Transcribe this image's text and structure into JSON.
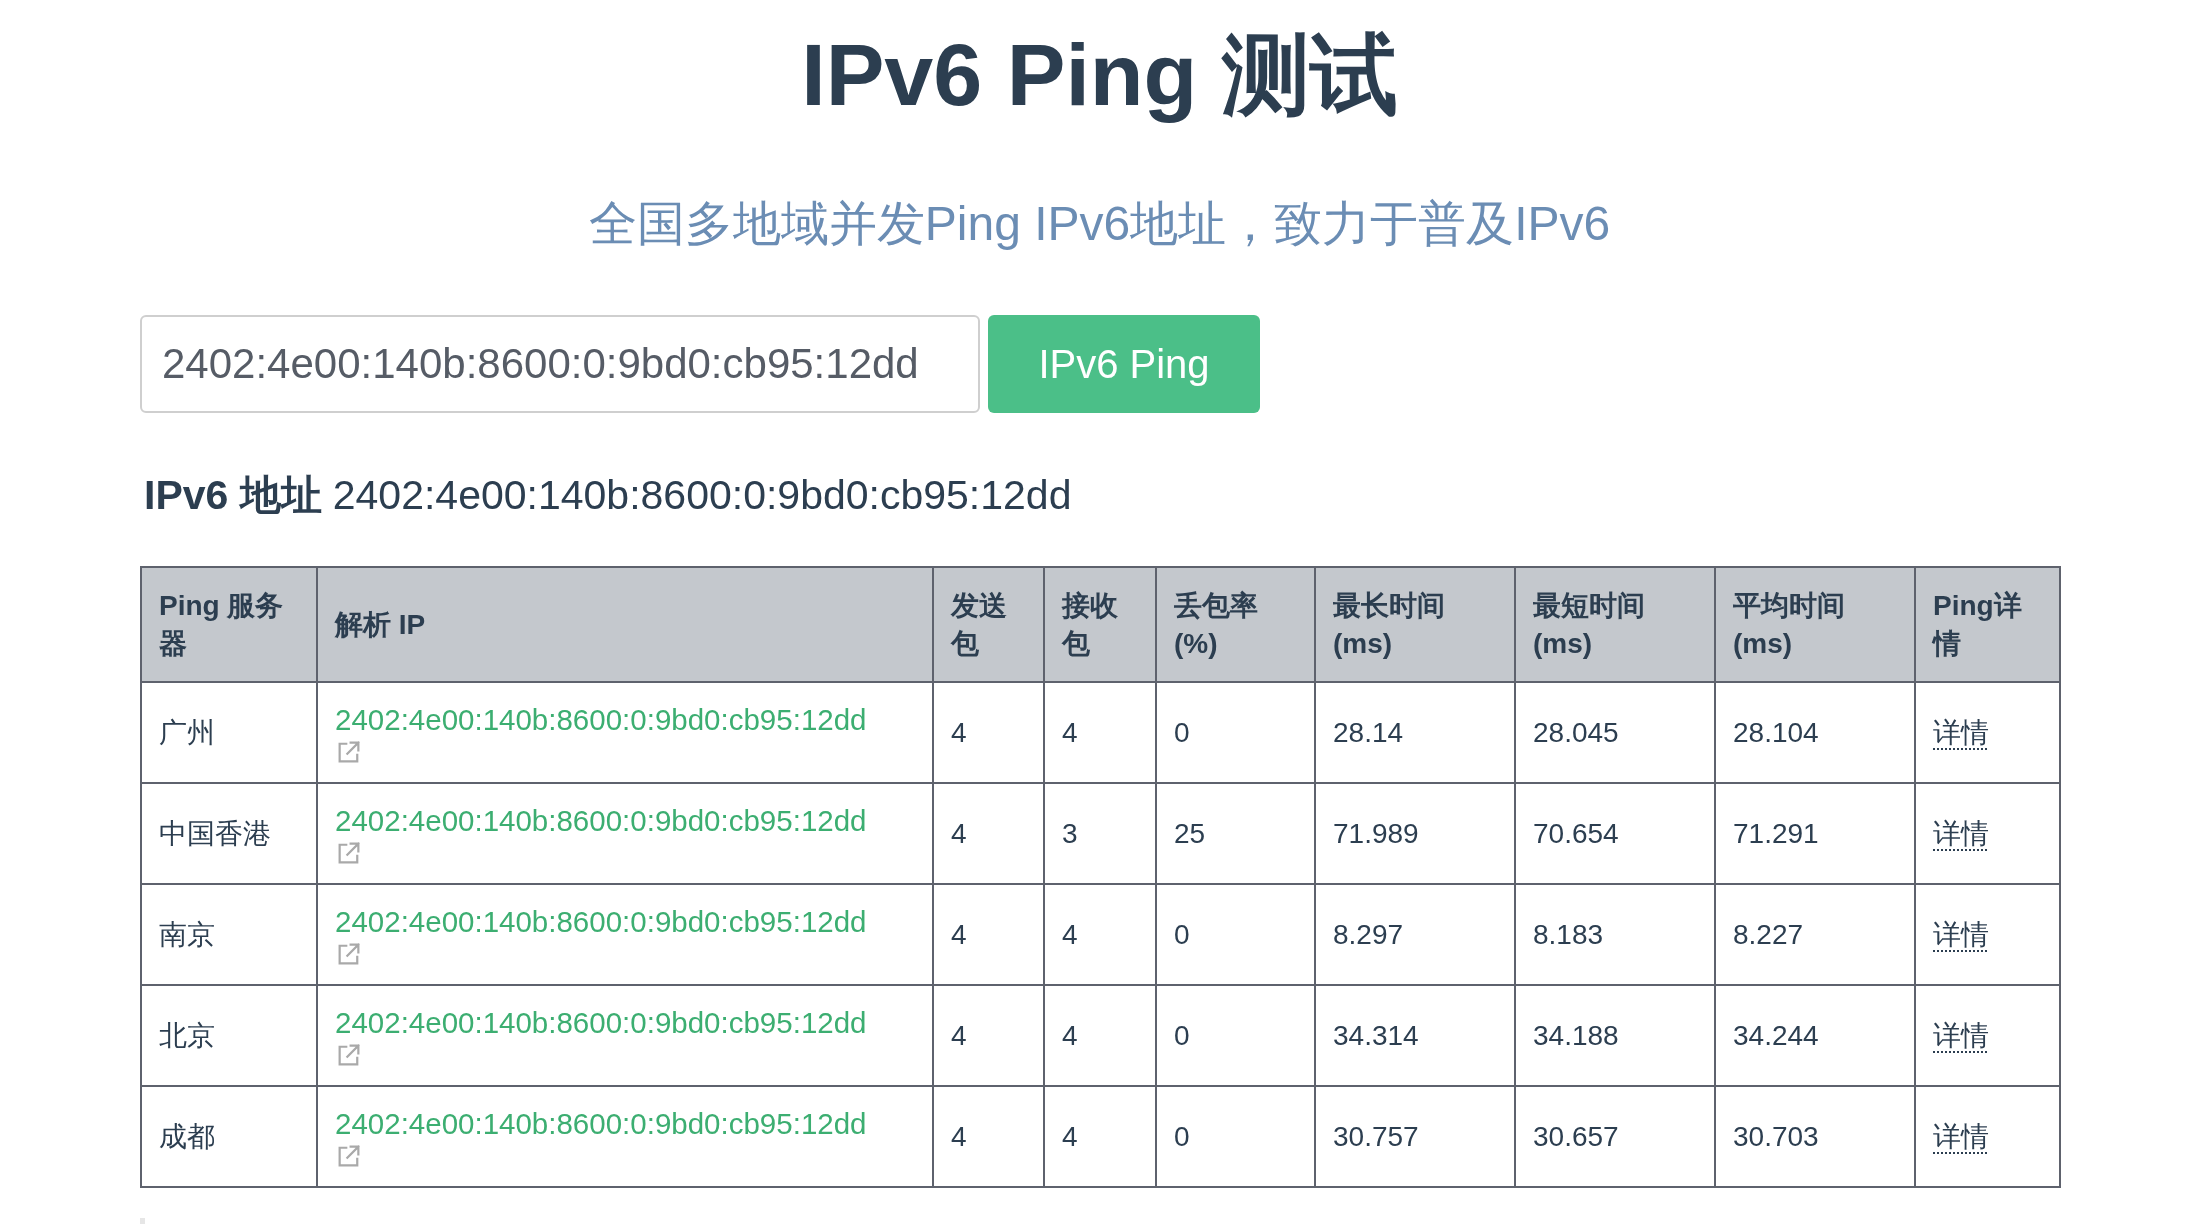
{
  "header": {
    "title": "IPv6 Ping 测试",
    "subtitle": "全国多地域并发Ping IPv6地址，致力于普及IPv6"
  },
  "form": {
    "address_input": {
      "value": "2402:4e00:140b:8600:0:9bd0:cb95:12dd"
    },
    "button": "IPv6 Ping"
  },
  "result": {
    "label": "IPv6 地址",
    "address": "2402:4e00:140b:8600:0:9bd0:cb95:12dd"
  },
  "table": {
    "columns": [
      "Ping 服务器",
      "解析 IP",
      "发送包",
      "接收包",
      "丢包率 (%)",
      "最长时间 (ms)",
      "最短时间 (ms)",
      "平均时间 (ms)",
      "Ping详情"
    ],
    "rows": [
      {
        "server": "广州",
        "ip": "2402:4e00:140b:8600:0:9bd0:cb95:12dd",
        "sent": "4",
        "received": "4",
        "loss": "0",
        "max": "28.14",
        "min": "28.045",
        "avg": "28.104",
        "detail": "详情"
      },
      {
        "server": "中国香港",
        "ip": "2402:4e00:140b:8600:0:9bd0:cb95:12dd",
        "sent": "4",
        "received": "3",
        "loss": "25",
        "max": "71.989",
        "min": "70.654",
        "avg": "71.291",
        "detail": "详情"
      },
      {
        "server": "南京",
        "ip": "2402:4e00:140b:8600:0:9bd0:cb95:12dd",
        "sent": "4",
        "received": "4",
        "loss": "0",
        "max": "8.297",
        "min": "8.183",
        "avg": "8.227",
        "detail": "详情"
      },
      {
        "server": "北京",
        "ip": "2402:4e00:140b:8600:0:9bd0:cb95:12dd",
        "sent": "4",
        "received": "4",
        "loss": "0",
        "max": "34.314",
        "min": "34.188",
        "avg": "34.244",
        "detail": "详情"
      },
      {
        "server": "成都",
        "ip": "2402:4e00:140b:8600:0:9bd0:cb95:12dd",
        "sent": "4",
        "received": "4",
        "loss": "0",
        "max": "30.757",
        "min": "30.657",
        "avg": "30.703",
        "detail": "详情"
      }
    ]
  }
}
